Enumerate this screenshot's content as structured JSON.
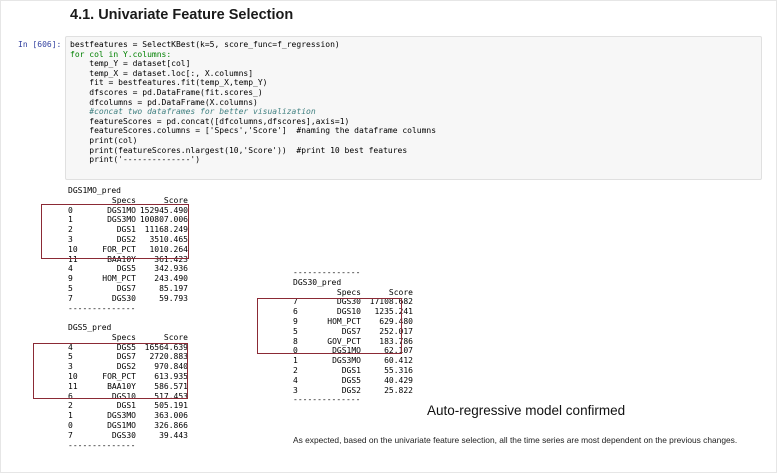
{
  "heading": "4.1. Univariate Feature Selection",
  "cell": {
    "prompt": "In [606]:",
    "code_lines": [
      {
        "text": "bestfeatures = SelectKBest(k=5, score_func=f_regression)",
        "kind": "normal"
      },
      {
        "text": "for col in Y.columns:",
        "kind": "kw"
      },
      {
        "text": "    temp_Y = dataset[col]",
        "kind": "normal"
      },
      {
        "text": "    temp_X = dataset.loc[:, X.columns]",
        "kind": "normal"
      },
      {
        "text": "    fit = bestfeatures.fit(temp_X,temp_Y)",
        "kind": "normal"
      },
      {
        "text": "    dfscores = pd.DataFrame(fit.scores_)",
        "kind": "normal"
      },
      {
        "text": "    dfcolumns = pd.DataFrame(X.columns)",
        "kind": "normal"
      },
      {
        "text": "    #concat two dataframes for better visualization",
        "kind": "cm"
      },
      {
        "text": "    featureScores = pd.concat([dfcolumns,dfscores],axis=1)",
        "kind": "normal"
      },
      {
        "text": "    featureScores.columns = ['Specs','Score']  #naming the dataframe columns",
        "kind": "normal"
      },
      {
        "text": "    print(col)",
        "kind": "normal"
      },
      {
        "text": "    print(featureScores.nlargest(10,'Score'))  #print 10 best features",
        "kind": "normal"
      },
      {
        "text": "    print('--------------')",
        "kind": "normal"
      }
    ]
  },
  "outputs": {
    "dgs1mo": {
      "title": "DGS1MO_pred",
      "col_specs": "Specs",
      "col_score": "Score",
      "rows": [
        [
          "0",
          "DGS1MO",
          "152945.490"
        ],
        [
          "1",
          "DGS3MO",
          "100807.006"
        ],
        [
          "2",
          "DGS1",
          "11168.249"
        ],
        [
          "3",
          "DGS2",
          "3510.465"
        ],
        [
          "10",
          "FOR_PCT",
          "1010.264"
        ],
        [
          "11",
          "BAA10Y",
          "361.423"
        ],
        [
          "4",
          "DGS5",
          "342.936"
        ],
        [
          "9",
          "HOM_PCT",
          "243.490"
        ],
        [
          "5",
          "DGS7",
          "85.197"
        ],
        [
          "7",
          "DGS30",
          "59.793"
        ]
      ],
      "separator": "--------------"
    },
    "dgs5": {
      "title": "DGS5_pred",
      "col_specs": "Specs",
      "col_score": "Score",
      "rows": [
        [
          "4",
          "DGS5",
          "16564.639"
        ],
        [
          "5",
          "DGS7",
          "2720.883"
        ],
        [
          "3",
          "DGS2",
          "970.840"
        ],
        [
          "10",
          "FOR_PCT",
          "613.935"
        ],
        [
          "11",
          "BAA10Y",
          "586.571"
        ],
        [
          "6",
          "DGS10",
          "517.453"
        ],
        [
          "2",
          "DGS1",
          "505.191"
        ],
        [
          "1",
          "DGS3MO",
          "363.006"
        ],
        [
          "0",
          "DGS1MO",
          "326.866"
        ],
        [
          "7",
          "DGS30",
          "39.443"
        ]
      ],
      "separator": "--------------"
    },
    "dgs30": {
      "separator_top": "--------------",
      "title": "DGS30_pred",
      "col_specs": "Specs",
      "col_score": "Score",
      "rows": [
        [
          "7",
          "DGS30",
          "17108.682"
        ],
        [
          "6",
          "DGS10",
          "1235.241"
        ],
        [
          "9",
          "HOM_PCT",
          "629.480"
        ],
        [
          "5",
          "DGS7",
          "252.017"
        ],
        [
          "8",
          "GOV_PCT",
          "183.786"
        ],
        [
          "0",
          "DGS1MO",
          "62.107"
        ],
        [
          "1",
          "DGS3MO",
          "60.412"
        ],
        [
          "2",
          "DGS1",
          "55.316"
        ],
        [
          "4",
          "DGS5",
          "40.429"
        ],
        [
          "3",
          "DGS2",
          "25.822"
        ]
      ],
      "separator": "--------------"
    }
  },
  "caption": "Auto-regressive model confirmed",
  "note": "As expected, based on the univariate feature selection, all the time series are most dependent on the previous changes."
}
